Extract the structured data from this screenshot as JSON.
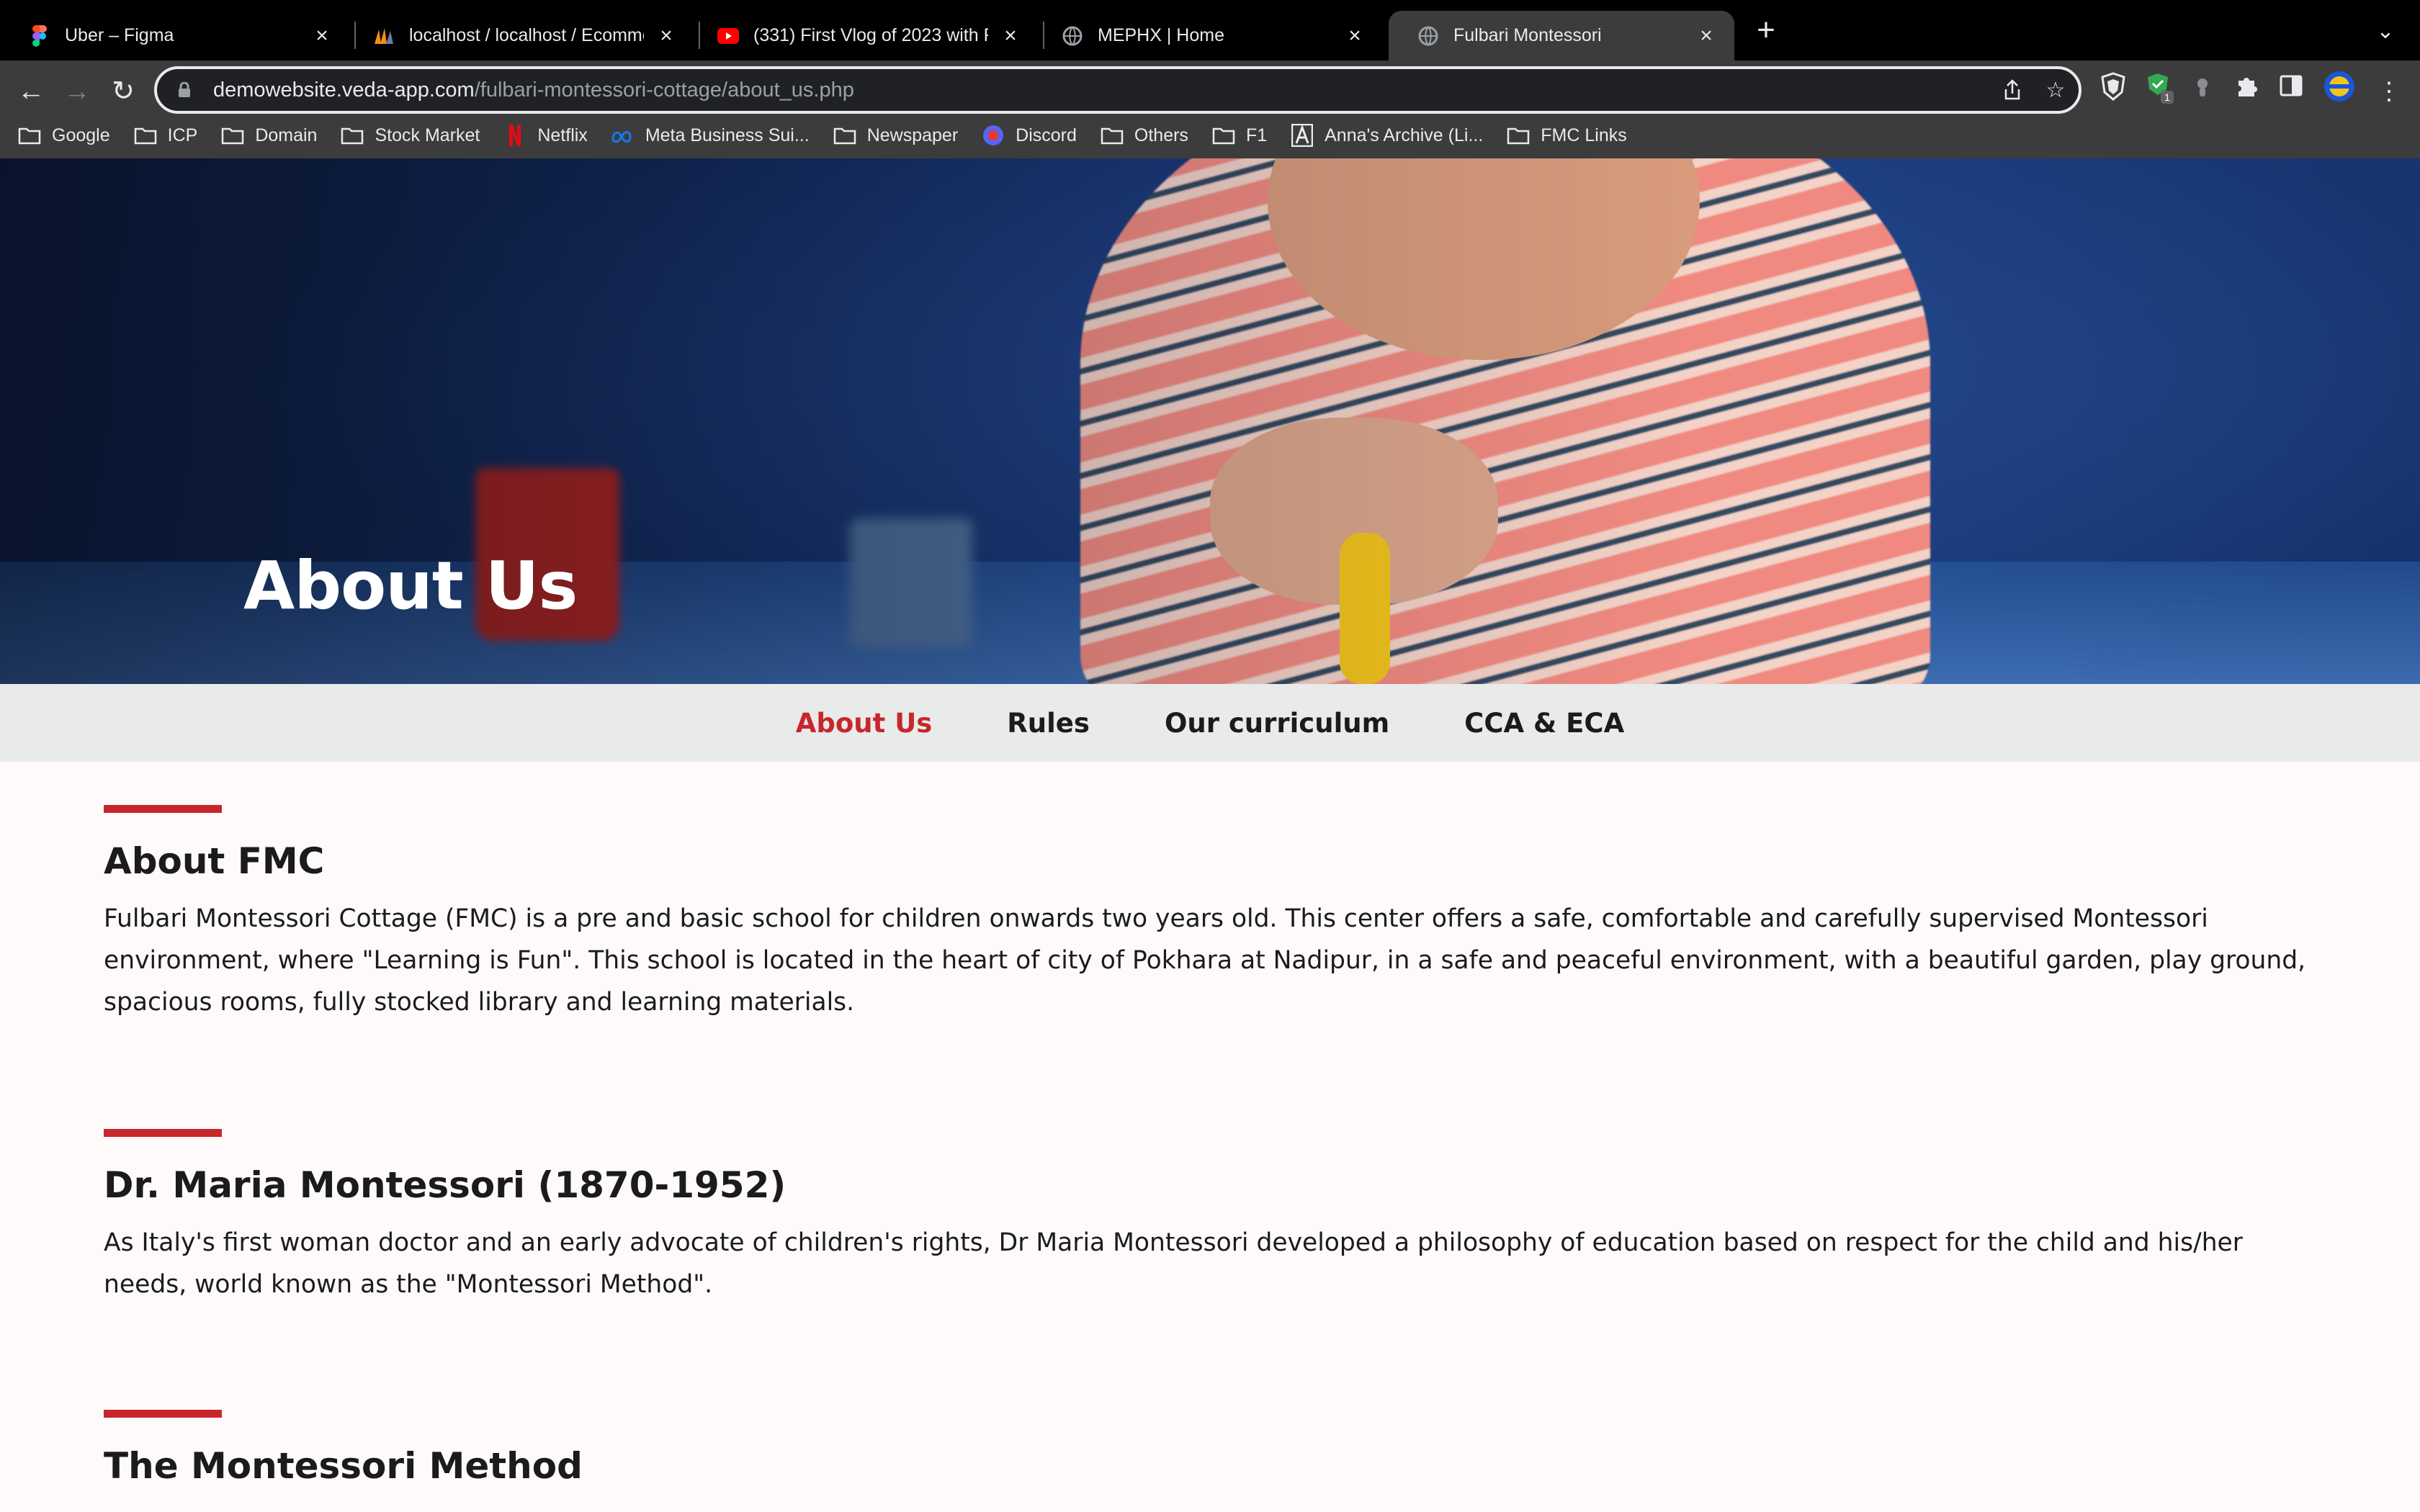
{
  "browser": {
    "tabs": [
      {
        "title": "Uber – Figma",
        "icon": "figma-icon",
        "active": false
      },
      {
        "title": "localhost / localhost / Ecomme",
        "icon": "phpmyadmin-icon",
        "active": false
      },
      {
        "title": "(331) First Vlog of 2023 with F",
        "icon": "youtube-icon",
        "active": false
      },
      {
        "title": "MEPHX | Home",
        "icon": "globe-icon",
        "active": false
      },
      {
        "title": "Fulbari Montessori",
        "icon": "globe-icon",
        "active": true
      }
    ],
    "url_host": "demowebsite.veda-app.com",
    "url_path": "/fulbari-montessori-cottage/about_us.php",
    "bookmarks": [
      {
        "label": "Google",
        "icon": "folder-icon"
      },
      {
        "label": "ICP",
        "icon": "folder-icon"
      },
      {
        "label": "Domain",
        "icon": "folder-icon"
      },
      {
        "label": "Stock Market",
        "icon": "folder-icon"
      },
      {
        "label": "Netflix",
        "icon": "netflix-icon"
      },
      {
        "label": "Meta Business Sui...",
        "icon": "meta-icon"
      },
      {
        "label": "Newspaper",
        "icon": "folder-icon"
      },
      {
        "label": "Discord",
        "icon": "discord-icon"
      },
      {
        "label": "Others",
        "icon": "folder-icon"
      },
      {
        "label": "F1",
        "icon": "folder-icon"
      },
      {
        "label": "Anna's Archive (Li...",
        "icon": "annas-archive-icon"
      },
      {
        "label": "FMC Links",
        "icon": "folder-icon"
      }
    ],
    "extension_badge": "1"
  },
  "hero": {
    "title": "About Us"
  },
  "subnav": {
    "items": [
      {
        "label": "About Us",
        "active": true
      },
      {
        "label": "Rules",
        "active": false
      },
      {
        "label": "Our curriculum",
        "active": false
      },
      {
        "label": "CCA & ECA",
        "active": false
      }
    ]
  },
  "sections": [
    {
      "heading": "About FMC",
      "body": "Fulbari Montessori Cottage (FMC) is a pre and basic school for children onwards two years old. This center offers a safe, comfortable and carefully supervised Montessori environment, where \"Learning is Fun\". This school is located in the heart of city of Pokhara at Nadipur, in a safe and peaceful environment, with a beautiful garden, play ground, spacious rooms, fully stocked library and learning materials."
    },
    {
      "heading": "Dr. Maria Montessori (1870-1952)",
      "body": "As Italy's first woman doctor and an early advocate of children's rights, Dr Maria Montessori developed a philosophy of education based on respect for the child and his/her needs, world known as the \"Montessori Method\"."
    },
    {
      "heading": "The Montessori Method",
      "body": ""
    }
  ],
  "colors": {
    "accent": "#c8262b",
    "subnav_bg": "#e8ebea",
    "page_bg": "#fdfaf9",
    "text": "#1b1b1b"
  }
}
